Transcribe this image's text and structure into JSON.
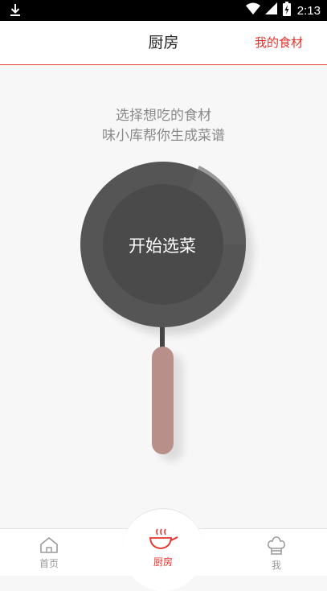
{
  "status_bar": {
    "time": "2:13"
  },
  "header": {
    "title": "厨房",
    "my_ingredients_link": "我的食材"
  },
  "prompt": {
    "line1": "选择想吃的食材",
    "line2": "味小库帮你生成菜谱"
  },
  "pan": {
    "button_label": "开始选菜",
    "pan_color": "#555555",
    "handle_color": "#b89089"
  },
  "tabbar": {
    "tabs": [
      {
        "label": "首页",
        "icon": "home-icon",
        "active": false
      },
      {
        "label": "厨房",
        "icon": "wok-icon",
        "active": true
      },
      {
        "label": "我",
        "icon": "chef-hat-icon",
        "active": false
      }
    ]
  },
  "colors": {
    "accent": "#e8302a",
    "background": "#f7f7f7"
  }
}
